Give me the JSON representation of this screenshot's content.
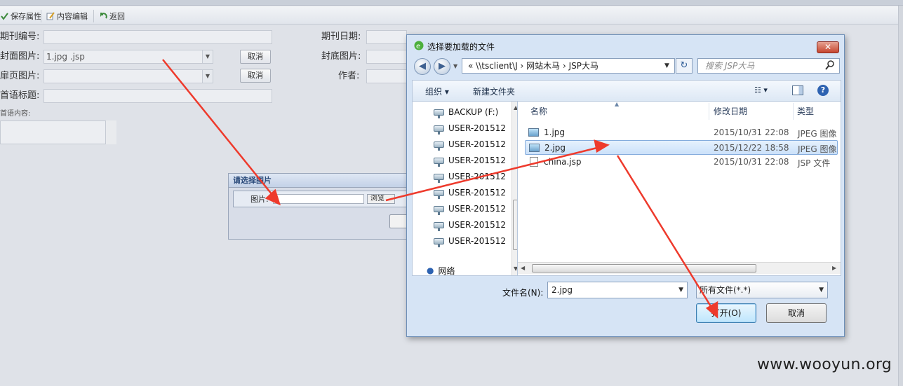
{
  "toolbar": {
    "save_attr": "保存属性",
    "edit_content": "内容编辑",
    "back": "返回"
  },
  "form": {
    "issue_no_label": "期刊编号:",
    "cover_label": "封面图片:",
    "cover_value": "1.jpg .jsp",
    "flyleaf_label": "扉页图片:",
    "preface_title_label": "首语标题:",
    "preface_content_label": "首语内容:",
    "cancel_label": "取消",
    "issue_date_label": "期刊日期:",
    "back_cover_label": "封底图片:",
    "author_label": "作者:"
  },
  "picker": {
    "title": "请选择图片",
    "image_label": "图片:",
    "browse_label": "浏览"
  },
  "dialog": {
    "title": "选择要加载的文件",
    "close": "✕",
    "address": "« \\\\tsclient\\J  ›  网站木马  ›  JSP大马",
    "search_placeholder": "搜索 JSP大马",
    "organize": "组织 ▾",
    "new_folder": "新建文件夹",
    "tree": [
      "BACKUP (F:)",
      "USER-201512",
      "USER-201512",
      "USER-201512",
      "USER-201512",
      "USER-201512",
      "USER-201512",
      "USER-201512",
      "USER-201512",
      "网络"
    ],
    "columns": {
      "name": "名称",
      "modified": "修改日期",
      "type": "类型"
    },
    "files": [
      {
        "name": "1.jpg",
        "modified": "2015/10/31 22:08",
        "type": "JPEG 图像"
      },
      {
        "name": "2.jpg",
        "modified": "2015/12/22 18:58",
        "type": "JPEG 图像"
      },
      {
        "name": "china.jsp",
        "modified": "2015/10/31 22:08",
        "type": "JSP 文件"
      }
    ],
    "filename_label": "文件名(N):",
    "filename_value": "2.jpg",
    "filetype_value": "所有文件(*.*)",
    "open_label": "打开(O)",
    "cancel_label": "取消"
  },
  "watermark": "www.wooyun.org",
  "colors": {
    "annotation_arrow": "#ee3a2c",
    "dialog_frame": "#6e8fb7"
  }
}
